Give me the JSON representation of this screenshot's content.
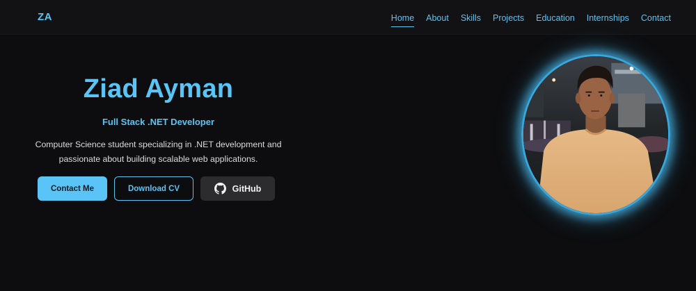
{
  "nav": {
    "logo": "ZA",
    "links": [
      {
        "label": "Home",
        "active": true
      },
      {
        "label": "About",
        "active": false
      },
      {
        "label": "Skills",
        "active": false
      },
      {
        "label": "Projects",
        "active": false
      },
      {
        "label": "Education",
        "active": false
      },
      {
        "label": "Internships",
        "active": false
      },
      {
        "label": "Contact",
        "active": false
      }
    ]
  },
  "hero": {
    "name": "Ziad Ayman",
    "role": "Full Stack .NET Developer",
    "description": "Computer Science student specializing in .NET development and passionate about building scalable web applications.",
    "buttons": {
      "contact": "Contact Me",
      "cv": "Download CV",
      "github": "GitHub"
    },
    "github_icon": "github-icon"
  },
  "colors": {
    "accent": "#59c4f5",
    "background": "#0d0d0f",
    "navbar": "#121214",
    "github_button": "#2c2c2e"
  }
}
